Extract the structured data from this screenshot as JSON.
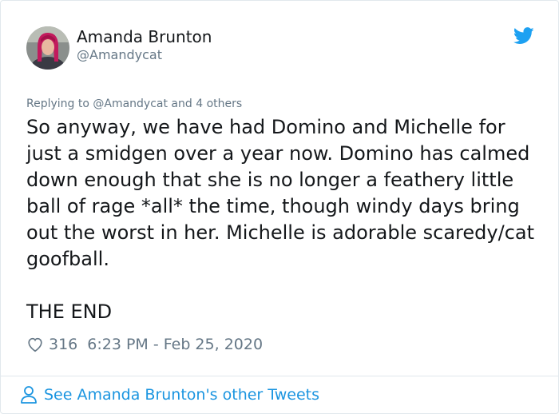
{
  "author": {
    "name": "Amanda Brunton",
    "handle": "@Amandycat"
  },
  "icons": {
    "logo": "twitter-bird-icon",
    "like": "heart-icon",
    "profile": "person-icon"
  },
  "colors": {
    "twitter_blue": "#1da1f2",
    "link_blue": "#1b95e0",
    "secondary_text": "#657786"
  },
  "tweet": {
    "replying_to": "Replying to @Amandycat and 4 others",
    "text": "So anyway, we have had Domino and Michelle for just a smidgen over a year now. Domino has calmed down enough that she is no longer a feathery little ball of rage *all* the time, though windy days bring out the worst in her. Michelle is adorable scaredy/cat goofball.\n\nTHE END",
    "likes": "316",
    "timestamp": "6:23 PM - Feb 25, 2020"
  },
  "footer": {
    "see_more_label": "See Amanda Brunton's other Tweets"
  }
}
